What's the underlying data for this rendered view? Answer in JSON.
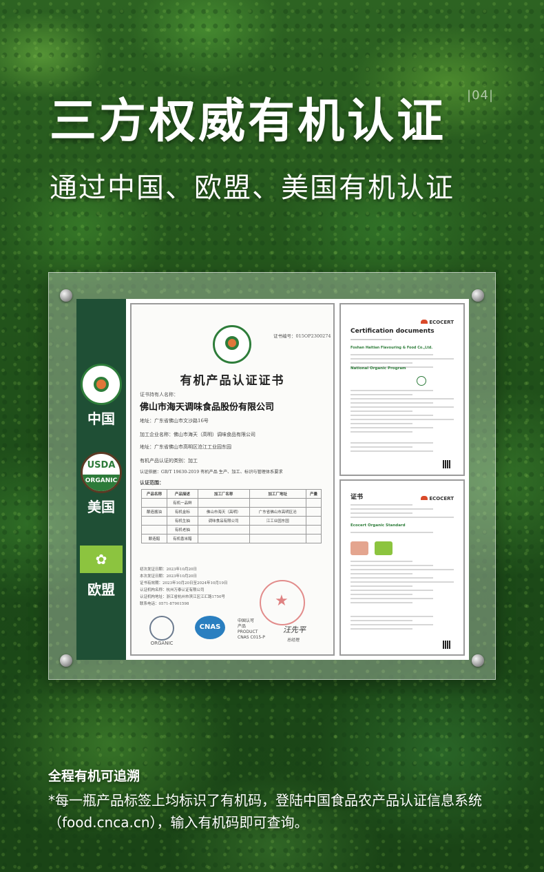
{
  "header": {
    "title": "三方权威有机认证",
    "page_number": "|04|",
    "subtitle": "通过中国、欧盟、美国有机认证"
  },
  "sidebar": {
    "items": [
      {
        "label": "中国",
        "icon": "china-organic-logo-icon"
      },
      {
        "label": "美国",
        "icon": "usda-organic-logo-icon",
        "logo_top": "USDA",
        "logo_bottom": "ORGANIC"
      },
      {
        "label": "欧盟",
        "icon": "eu-organic-leaf-logo-icon"
      }
    ]
  },
  "certificate_main": {
    "number": "证书编号：015OP2300274",
    "title": "有机产品认证证书",
    "holder_label": "证书持有人名称：",
    "holder": "佛山市海天调味食品股份有限公司",
    "address": "地址：广东省佛山市文沙路16号",
    "processor": "加工企业名称：佛山市海天（高明）调味食品有限公司",
    "processor_address": "地址：广东省佛山市高明区沧江工业园东园",
    "cert_type": "有机产品认证的类别：加工",
    "cert_basis": "认证依据：GB/T 19630-2019 有机产品 生产、加工、标识与管理体系要求",
    "scope_label": "认证范围：",
    "table_headers": [
      "产品名称",
      "产品描述",
      "加工厂名称",
      "加工厂地址",
      "产量"
    ],
    "table_rows": [
      [
        "",
        "有机一品鲜",
        "",
        "",
        ""
      ],
      [
        "酿造酱油",
        "有机金标",
        "佛山市海天（高明）",
        "广东省佛山市高明区沧",
        ""
      ],
      [
        "",
        "有机生抽",
        "调味食品有限公司",
        "江工业园东园",
        ""
      ],
      [
        "",
        "有机老抽",
        "",
        "",
        ""
      ],
      [
        "酿造醋",
        "有机香米醋",
        "",
        "",
        ""
      ]
    ],
    "issue_date": "初次发证日期：2023年10月20日",
    "valid_from": "本次发证日期：2023年10月20日",
    "valid_period": "证书有效期：2023年10月20日至2024年10月19日",
    "issuer": "认证机构名称：杭州万泰认证有限公司",
    "issuer_address": "认证机构地址：浙江省杭州市滨江区江汇路1750号",
    "phone": "联系电话：0571-87901598",
    "logo_organic": "ORGANIC",
    "logo_cnas": "CNAS",
    "cnas_text": [
      "中国认可",
      "产品",
      "PRODUCT",
      "CNAS C015-P"
    ],
    "signature": "汪先平",
    "signature_title": "总经理"
  },
  "doc_ecocert_us": {
    "brand": "ECOCERT",
    "title": "Certification documents",
    "company": "Foshan Haitian Flavouring & Food Co.,Ltd.",
    "program": "National Organic Program"
  },
  "doc_ecocert_eu": {
    "brand": "ECOCERT",
    "title": "证书",
    "standard": "Ecocert Organic Standard"
  },
  "footer": {
    "title": "全程有机可追溯",
    "text": "*每一瓶产品标签上均标识了有机码，登陆中国食品农产品认证信息系统（food.cnca.cn），输入有机码即可查询。"
  }
}
